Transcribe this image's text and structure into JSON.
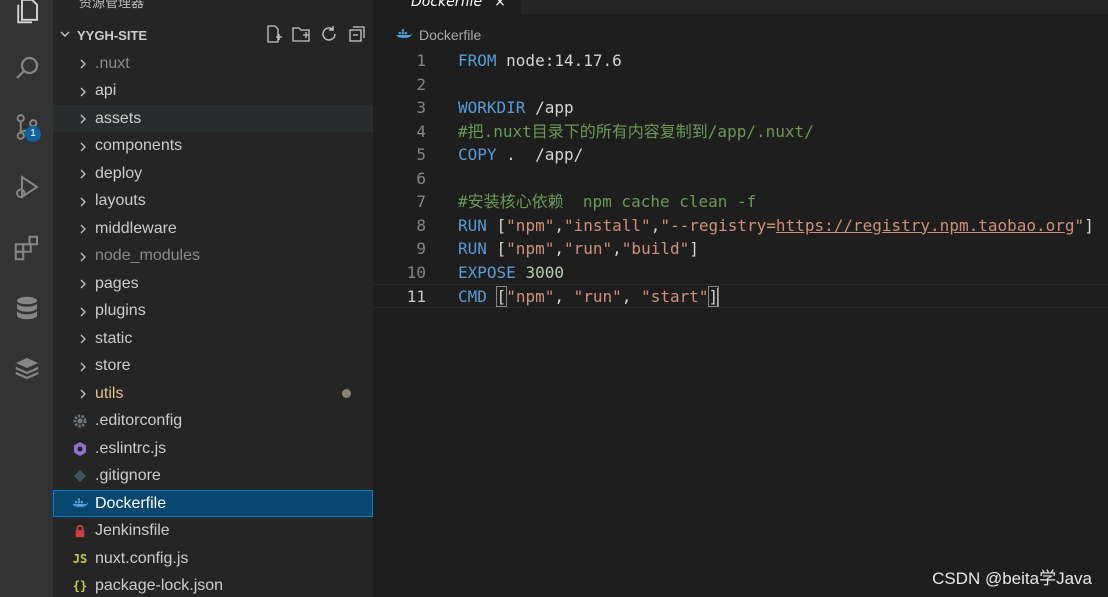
{
  "sidebar": {
    "title": "资源管理器",
    "more": "···",
    "folder_name": "YYGH-SITE",
    "items": [
      {
        "label": ".nuxt",
        "type": "folder",
        "dim": true
      },
      {
        "label": "api",
        "type": "folder"
      },
      {
        "label": "assets",
        "type": "folder",
        "hover": true
      },
      {
        "label": "components",
        "type": "folder"
      },
      {
        "label": "deploy",
        "type": "folder"
      },
      {
        "label": "layouts",
        "type": "folder"
      },
      {
        "label": "middleware",
        "type": "folder"
      },
      {
        "label": "node_modules",
        "type": "folder",
        "dim": true
      },
      {
        "label": "pages",
        "type": "folder"
      },
      {
        "label": "plugins",
        "type": "folder"
      },
      {
        "label": "static",
        "type": "folder"
      },
      {
        "label": "store",
        "type": "folder"
      },
      {
        "label": "utils",
        "type": "folder",
        "modified": true
      },
      {
        "label": ".editorconfig",
        "type": "file",
        "icon": "gear-icon"
      },
      {
        "label": ".eslintrc.js",
        "type": "file",
        "icon": "eslint-icon"
      },
      {
        "label": ".gitignore",
        "type": "file",
        "icon": "git-icon"
      },
      {
        "label": "Dockerfile",
        "type": "file",
        "icon": "docker-icon",
        "selected": true
      },
      {
        "label": "Jenkinsfile",
        "type": "file",
        "icon": "jenkins-icon"
      },
      {
        "label": "nuxt.config.js",
        "type": "file",
        "icon": "js-icon",
        "icon_text": "JS"
      },
      {
        "label": "package-lock.json",
        "type": "file",
        "icon": "json-icon",
        "icon_text": "{}"
      }
    ]
  },
  "activity": {
    "source_control_badge": "1",
    "icons": [
      "explorer-icon",
      "search-icon",
      "source-control-icon",
      "run-debug-icon",
      "extensions-icon",
      "database-icon",
      "redis-icon"
    ]
  },
  "editor": {
    "tab_label": "Dockerfile",
    "tab_close": "×",
    "breadcrumb": "Dockerfile",
    "active_line": 11,
    "lines": [
      {
        "n": "1",
        "tokens": [
          {
            "t": "FROM",
            "c": "kw"
          },
          {
            "t": " node:14.17.6",
            "c": "txt"
          }
        ]
      },
      {
        "n": "2",
        "tokens": []
      },
      {
        "n": "3",
        "tokens": [
          {
            "t": "WORKDIR",
            "c": "kw"
          },
          {
            "t": " /app",
            "c": "txt"
          }
        ]
      },
      {
        "n": "4",
        "tokens": [
          {
            "t": "#把.nuxt目录下的所有内容复制到/app/.nuxt/",
            "c": "cm"
          }
        ]
      },
      {
        "n": "5",
        "tokens": [
          {
            "t": "COPY",
            "c": "kw"
          },
          {
            "t": " .  /app/",
            "c": "txt"
          }
        ]
      },
      {
        "n": "6",
        "tokens": []
      },
      {
        "n": "7",
        "tokens": [
          {
            "t": "#安装核心依赖  npm cache clean -f",
            "c": "cm"
          }
        ]
      },
      {
        "n": "8",
        "tokens": [
          {
            "t": "RUN",
            "c": "kw"
          },
          {
            "t": " [",
            "c": "txt"
          },
          {
            "t": "\"npm\"",
            "c": "str"
          },
          {
            "t": ",",
            "c": "txt"
          },
          {
            "t": "\"install\"",
            "c": "str"
          },
          {
            "t": ",",
            "c": "txt"
          },
          {
            "t": "\"--registry=",
            "c": "str"
          },
          {
            "t": "https://registry.npm.taobao.org",
            "c": "url"
          },
          {
            "t": "\"",
            "c": "str"
          },
          {
            "t": "]",
            "c": "txt"
          }
        ]
      },
      {
        "n": "9",
        "tokens": [
          {
            "t": "RUN",
            "c": "kw"
          },
          {
            "t": " [",
            "c": "txt"
          },
          {
            "t": "\"npm\"",
            "c": "str"
          },
          {
            "t": ",",
            "c": "txt"
          },
          {
            "t": "\"run\"",
            "c": "str"
          },
          {
            "t": ",",
            "c": "txt"
          },
          {
            "t": "\"build\"",
            "c": "str"
          },
          {
            "t": "]",
            "c": "txt"
          }
        ]
      },
      {
        "n": "10",
        "tokens": [
          {
            "t": "EXPOSE",
            "c": "kw"
          },
          {
            "t": " ",
            "c": "txt"
          },
          {
            "t": "3000",
            "c": "num"
          }
        ]
      },
      {
        "n": "11",
        "tokens": [
          {
            "t": "CMD",
            "c": "kw"
          },
          {
            "t": " ",
            "c": "txt"
          },
          {
            "t": "[",
            "c": "txt bracket-hl"
          },
          {
            "t": "\"npm\"",
            "c": "str"
          },
          {
            "t": ", ",
            "c": "txt"
          },
          {
            "t": "\"run\"",
            "c": "str"
          },
          {
            "t": ", ",
            "c": "txt"
          },
          {
            "t": "\"start\"",
            "c": "str"
          },
          {
            "t": "]",
            "c": "txt bracket-hl"
          }
        ]
      }
    ]
  },
  "watermark": "CSDN @beita学Java",
  "colors": {
    "keyword": "#569cd6",
    "string": "#ce9178",
    "comment": "#6a9955",
    "selection": "#094771",
    "modified_folder": "#e2c08d"
  }
}
